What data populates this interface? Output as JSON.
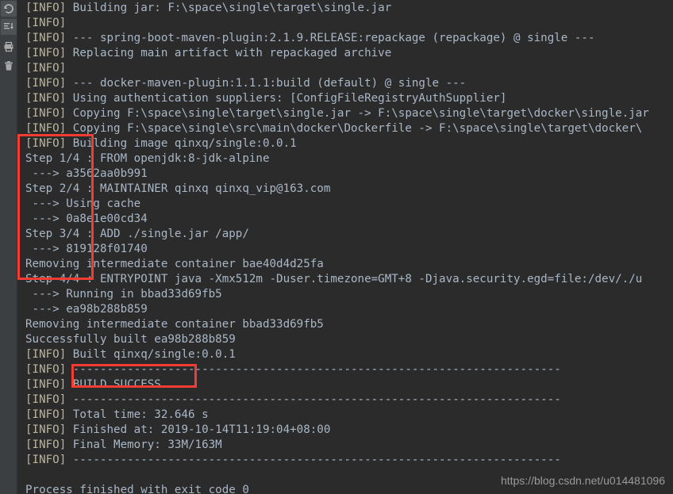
{
  "app": {
    "window_title": "Run console output",
    "background_color": "#2b2b2b",
    "gutter_color": "#3c3f41",
    "text_color": "#a9b7c6",
    "annotation_color": "#f43c32"
  },
  "gutter": {
    "buttons": [
      {
        "name": "rerun-icon",
        "title": "Rerun"
      },
      {
        "name": "scroll-to-end-icon",
        "title": "Scroll to end"
      },
      {
        "name": "print-icon",
        "title": "Print"
      },
      {
        "name": "trash-icon",
        "title": "Clear all"
      }
    ]
  },
  "console": {
    "lines": [
      {
        "prefix": "[INFO]",
        "text": " Building jar: F:\\space\\single\\target\\single.jar"
      },
      {
        "prefix": "[INFO]",
        "text": ""
      },
      {
        "prefix": "[INFO]",
        "text": " --- spring-boot-maven-plugin:2.1.9.RELEASE:repackage (repackage) @ single ---"
      },
      {
        "prefix": "[INFO]",
        "text": " Replacing main artifact with repackaged archive"
      },
      {
        "prefix": "[INFO]",
        "text": ""
      },
      {
        "prefix": "[INFO]",
        "text": " --- docker-maven-plugin:1.1.1:build (default) @ single ---"
      },
      {
        "prefix": "[INFO]",
        "text": " Using authentication suppliers: [ConfigFileRegistryAuthSupplier]"
      },
      {
        "prefix": "[INFO]",
        "text": " Copying F:\\space\\single\\target\\single.jar -> F:\\space\\single\\target\\docker\\single.jar"
      },
      {
        "prefix": "[INFO]",
        "text": " Copying F:\\space\\single\\src\\main\\docker\\Dockerfile -> F:\\space\\single\\target\\docker\\"
      },
      {
        "prefix": "[INFO]",
        "text": " Building image qinxq/single:0.0.1"
      },
      {
        "prefix": "",
        "text": "Step 1/4 : FROM openjdk:8-jdk-alpine"
      },
      {
        "prefix": "",
        "text": " ---> a3562aa0b991"
      },
      {
        "prefix": "",
        "text": "Step 2/4 : MAINTAINER qinxq qinxq_vip@163.com"
      },
      {
        "prefix": "",
        "text": " ---> Using cache"
      },
      {
        "prefix": "",
        "text": " ---> 0a8e1e00cd34"
      },
      {
        "prefix": "",
        "text": "Step 3/4 : ADD ./single.jar /app/"
      },
      {
        "prefix": "",
        "text": " ---> 819128f01740"
      },
      {
        "prefix": "",
        "text": "Removing intermediate container bae40d4d25fa"
      },
      {
        "prefix": "",
        "text": "Step 4/4 : ENTRYPOINT java -Xmx512m -Duser.timezone=GMT+8 -Djava.security.egd=file:/dev/./u"
      },
      {
        "prefix": "",
        "text": " ---> Running in bbad33d69fb5"
      },
      {
        "prefix": "",
        "text": " ---> ea98b288b859"
      },
      {
        "prefix": "",
        "text": "Removing intermediate container bbad33d69fb5"
      },
      {
        "prefix": "",
        "text": "Successfully built ea98b288b859"
      },
      {
        "prefix": "[INFO]",
        "text": " Built qinxq/single:0.0.1"
      },
      {
        "prefix": "[INFO]",
        "text": " ------------------------------------------------------------------------"
      },
      {
        "prefix": "[INFO]",
        "text": " BUILD SUCCESS"
      },
      {
        "prefix": "[INFO]",
        "text": " ------------------------------------------------------------------------"
      },
      {
        "prefix": "[INFO]",
        "text": " Total time: 32.646 s"
      },
      {
        "prefix": "[INFO]",
        "text": " Finished at: 2019-10-14T11:19:04+08:00"
      },
      {
        "prefix": "[INFO]",
        "text": " Final Memory: 33M/163M"
      },
      {
        "prefix": "[INFO]",
        "text": " ------------------------------------------------------------------------"
      },
      {
        "prefix": "",
        "text": ""
      },
      {
        "prefix": "",
        "text": "Process finished with exit code 0"
      }
    ]
  },
  "annotations": {
    "steps_box_label": "docker build steps highlight",
    "build_success_box_label": "BUILD SUCCESS highlight"
  },
  "watermark": {
    "text": "https://blog.csdn.net/u014481096"
  }
}
